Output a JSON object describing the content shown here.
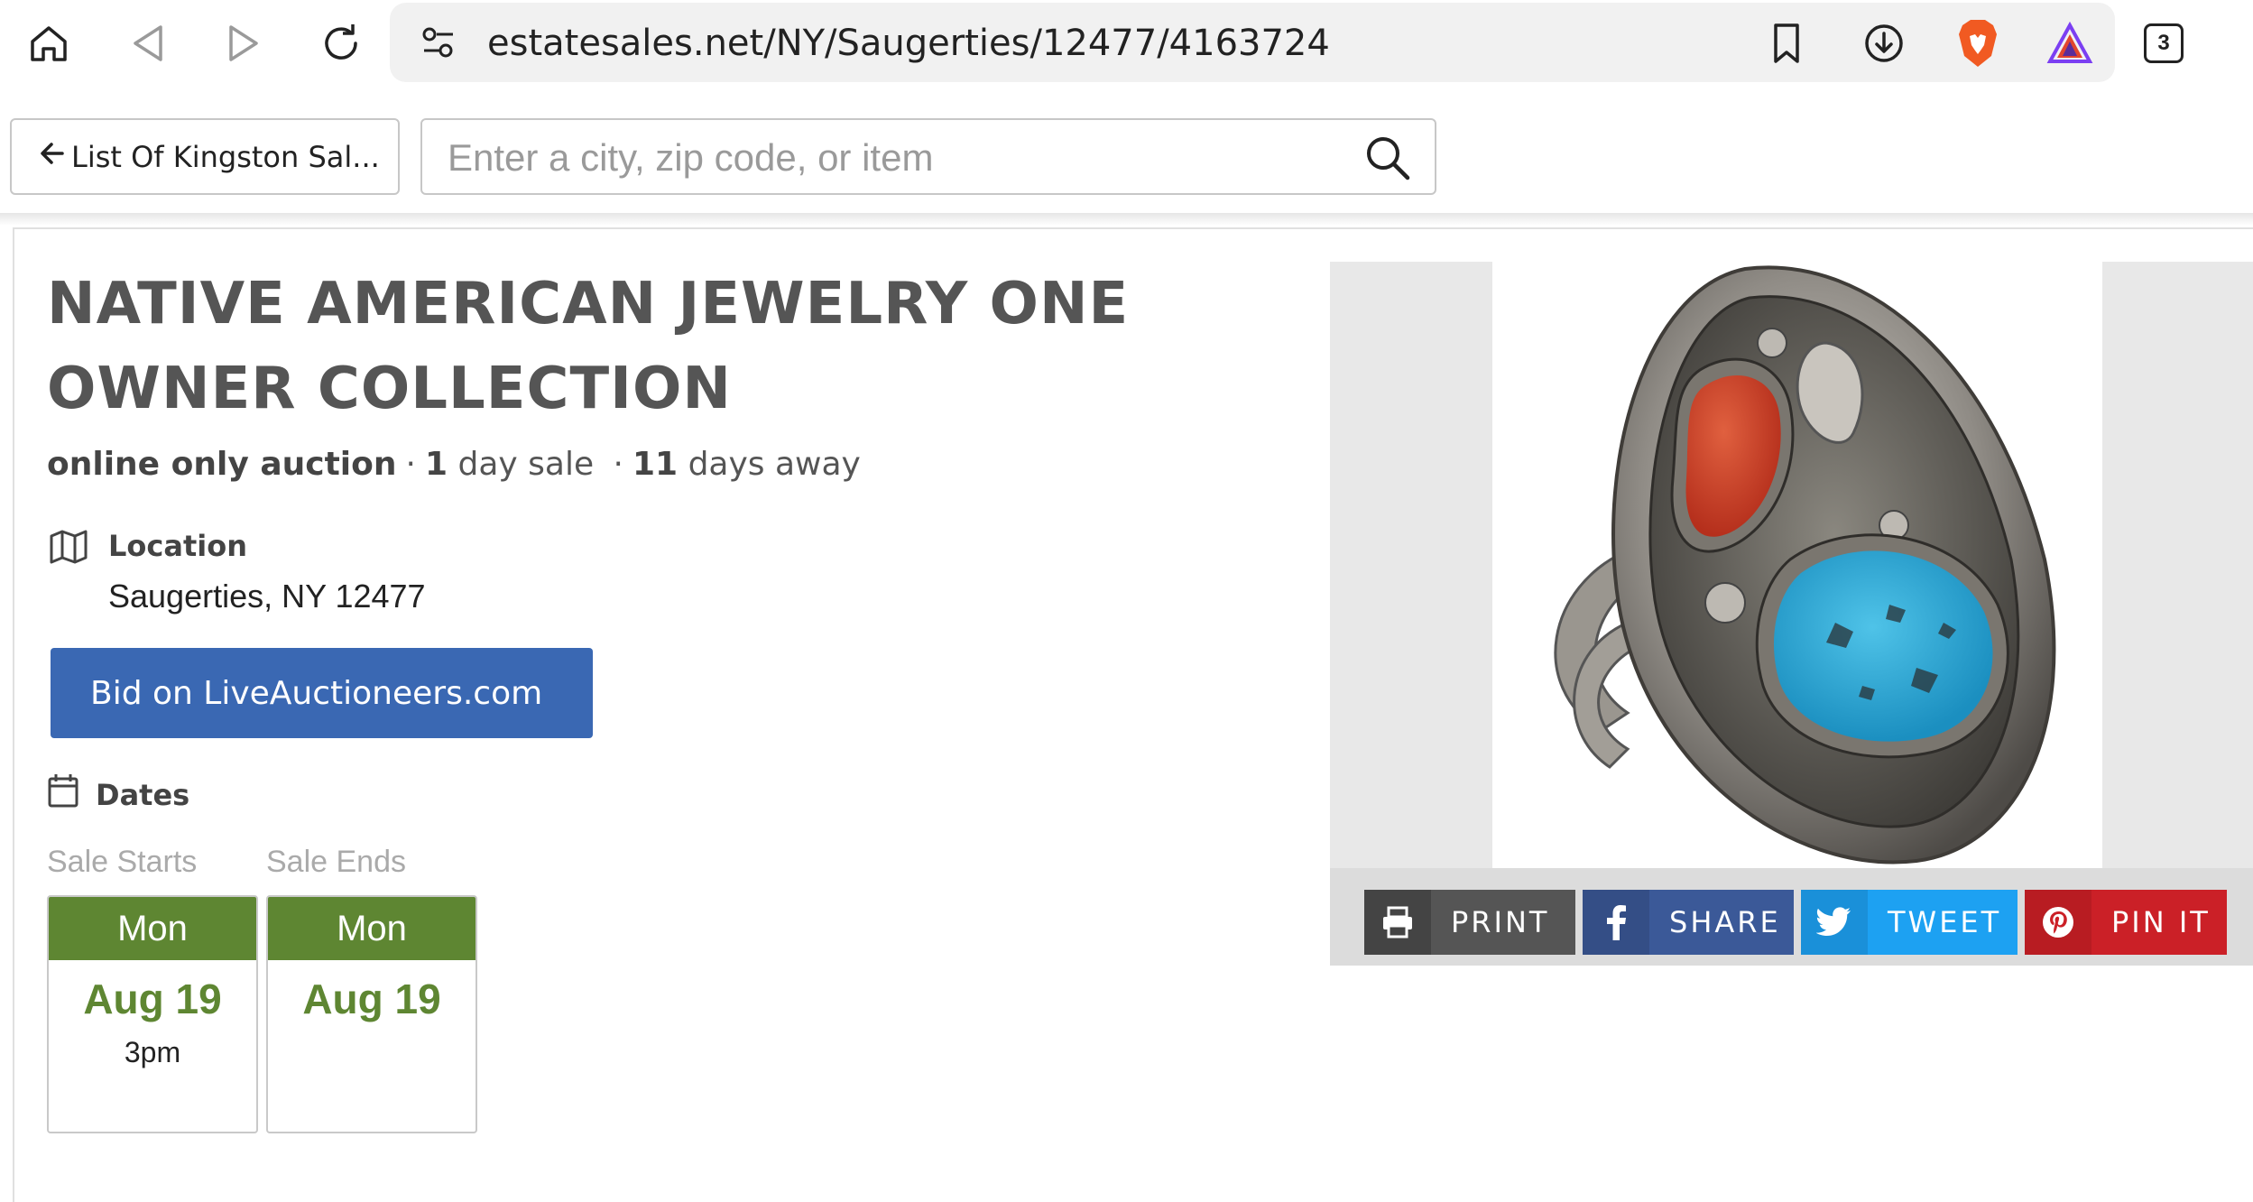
{
  "browser": {
    "url": "estatesales.net/NY/Saugerties/12477/4163724",
    "tab_count": "3"
  },
  "toolbar": {
    "back_label": "List Of Kingston Sal...",
    "search_placeholder": "Enter a city, zip code, or item"
  },
  "sale": {
    "title": "NATIVE AMERICAN JEWELRY ONE OWNER COLLECTION",
    "type": "online only auction",
    "duration_num": "1",
    "duration_text": "day sale",
    "away_num": "11",
    "away_text": "days away",
    "location_label": "Location",
    "location": "Saugerties, NY 12477",
    "bid_button": "Bid on LiveAuctioneers.com",
    "dates_label": "Dates",
    "start": {
      "caption": "Sale Starts",
      "dow": "Mon",
      "date": "Aug 19",
      "time": "3pm"
    },
    "end": {
      "caption": "Sale Ends",
      "dow": "Mon",
      "date": "Aug 19"
    }
  },
  "share": {
    "print": "PRINT",
    "share": "SHARE",
    "tweet": "TWEET",
    "pin": "PIN IT"
  },
  "colors": {
    "bid_blue": "#3a68b3",
    "date_green": "#5e8632",
    "facebook": "#3b5998",
    "twitter": "#1da1f2",
    "pinterest": "#cb2027"
  }
}
